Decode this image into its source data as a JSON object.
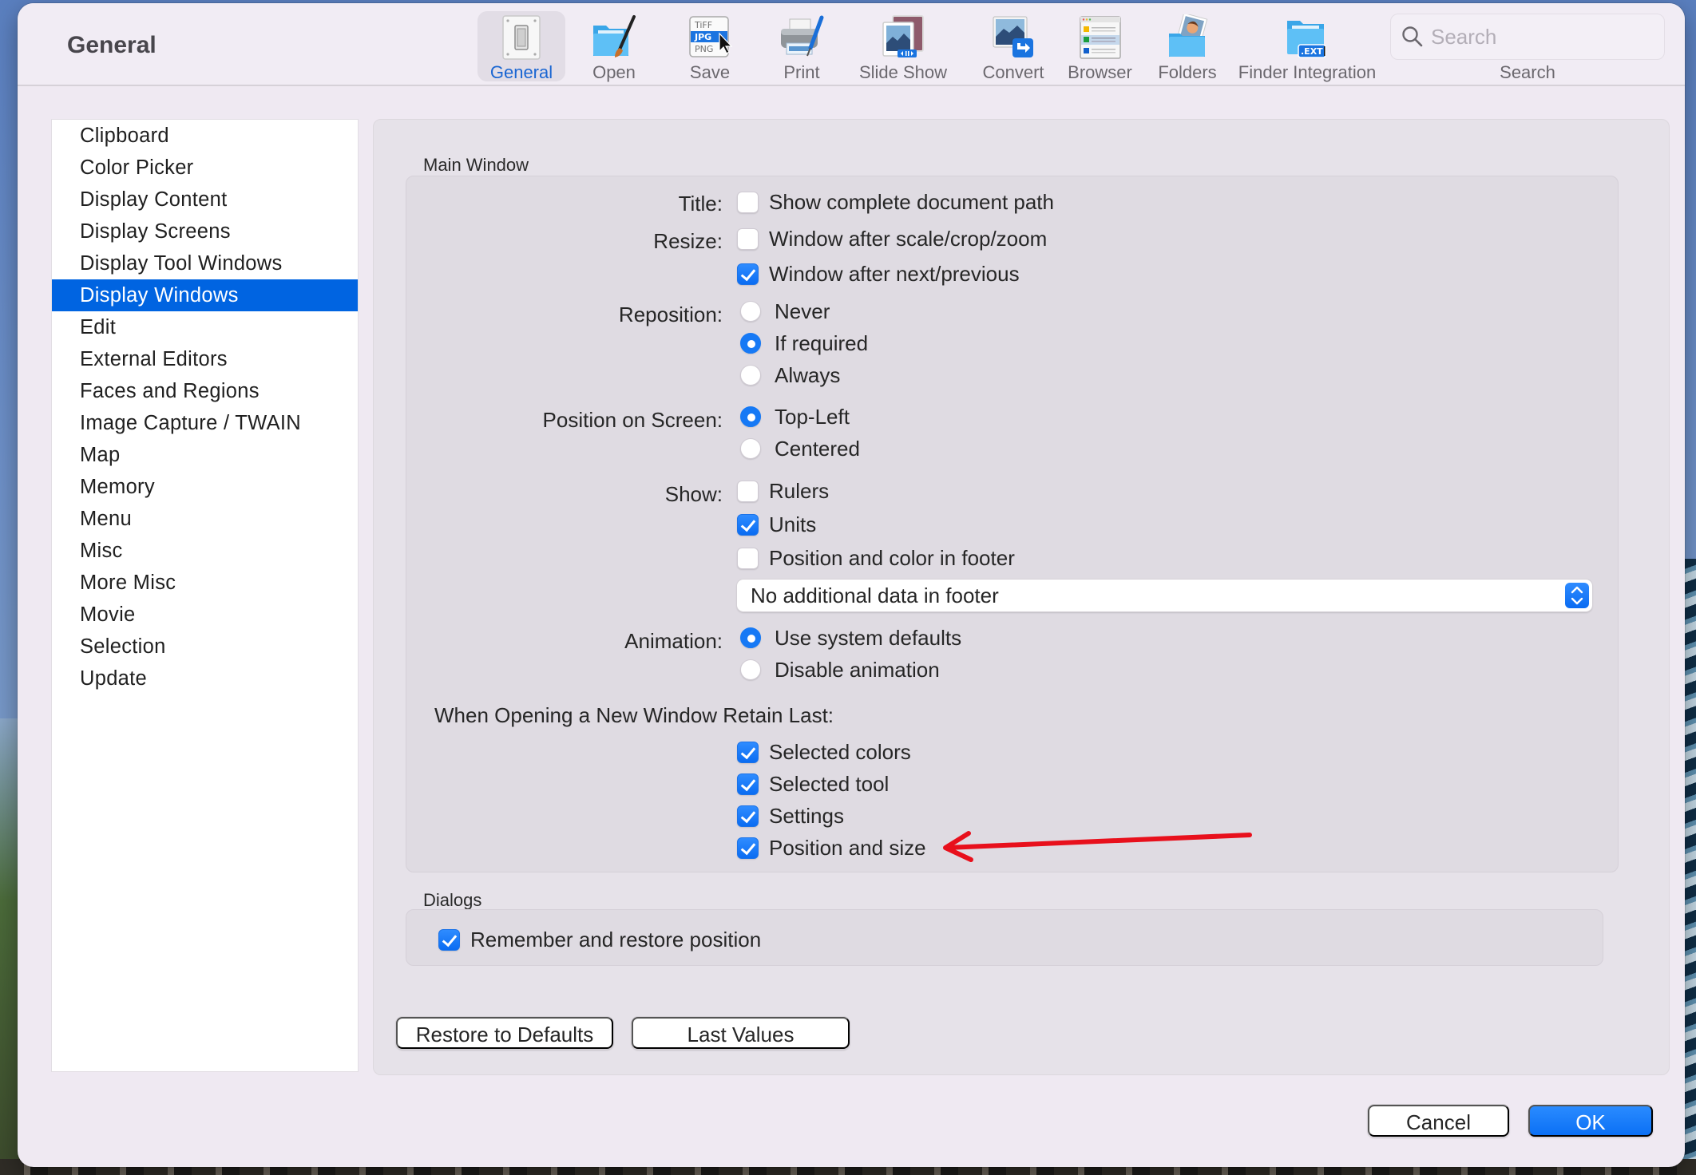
{
  "window": {
    "title": "General"
  },
  "toolbar": {
    "items": [
      {
        "id": "general",
        "label": "General",
        "icon": "light-switch-icon",
        "active": true
      },
      {
        "id": "open",
        "label": "Open",
        "icon": "folder-brush-icon",
        "active": false
      },
      {
        "id": "save",
        "label": "Save",
        "icon": "file-formats-icon",
        "active": false
      },
      {
        "id": "print",
        "label": "Print",
        "icon": "printer-icon",
        "active": false
      },
      {
        "id": "slideshow",
        "label": "Slide Show",
        "icon": "slideshow-icon",
        "active": false
      },
      {
        "id": "convert",
        "label": "Convert",
        "icon": "convert-icon",
        "active": false
      },
      {
        "id": "browser",
        "label": "Browser",
        "icon": "browser-icon",
        "active": false
      },
      {
        "id": "folders",
        "label": "Folders",
        "icon": "folders-icon",
        "active": false
      },
      {
        "id": "finder",
        "label": "Finder Integration",
        "icon": "finder-ext-icon",
        "active": false
      }
    ],
    "save_icon_text": {
      "tiff": "TiFF",
      "jpg": "JPG",
      "png": "PNG"
    },
    "finder_icon_text": ".EXT",
    "search": {
      "placeholder": "Search",
      "value": "",
      "caption": "Search"
    }
  },
  "sidebar": {
    "selected": "Display Windows",
    "items": [
      "Clipboard",
      "Color Picker",
      "Display Content",
      "Display Screens",
      "Display Tool Windows",
      "Display Windows",
      "Edit",
      "External Editors",
      "Faces and Regions",
      "Image Capture / TWAIN",
      "Map",
      "Memory",
      "Menu",
      "Misc",
      "More Misc",
      "Movie",
      "Selection",
      "Update"
    ]
  },
  "main_window": {
    "group_title": "Main Window",
    "title_label": "Title:",
    "title_options": [
      {
        "label": "Show complete document path",
        "checked": false
      }
    ],
    "resize_label": "Resize:",
    "resize_options": [
      {
        "label": "Window after scale/crop/zoom",
        "checked": false
      },
      {
        "label": "Window after next/previous",
        "checked": true
      }
    ],
    "reposition_label": "Reposition:",
    "reposition_options": [
      {
        "label": "Never",
        "selected": false
      },
      {
        "label": "If required",
        "selected": true
      },
      {
        "label": "Always",
        "selected": false
      }
    ],
    "position_label": "Position on Screen:",
    "position_options": [
      {
        "label": "Top-Left",
        "selected": true
      },
      {
        "label": "Centered",
        "selected": false
      }
    ],
    "show_label": "Show:",
    "show_options": [
      {
        "label": "Rulers",
        "checked": false
      },
      {
        "label": "Units",
        "checked": true
      },
      {
        "label": "Position and color in footer",
        "checked": false
      }
    ],
    "footer_select": {
      "value": "No additional data in footer"
    },
    "animation_label": "Animation:",
    "animation_options": [
      {
        "label": "Use system defaults",
        "selected": true
      },
      {
        "label": "Disable animation",
        "selected": false
      }
    ],
    "retain_label": "When Opening a New Window Retain Last:",
    "retain_options": [
      {
        "label": "Selected colors",
        "checked": true
      },
      {
        "label": "Selected tool",
        "checked": true
      },
      {
        "label": "Settings",
        "checked": true
      },
      {
        "label": "Position and size",
        "checked": true
      }
    ]
  },
  "dialogs": {
    "group_title": "Dialogs",
    "options": [
      {
        "label": "Remember and restore position",
        "checked": true
      }
    ]
  },
  "buttons": {
    "restore_defaults": "Restore to Defaults",
    "last_values": "Last Values",
    "cancel": "Cancel",
    "ok": "OK"
  },
  "annotation": {
    "type": "arrow",
    "color": "#e8101c",
    "points_to": "Position and size"
  },
  "colors": {
    "accent": "#0a6cf2",
    "selection": "#0064e1",
    "window_bg": "#efe9f2"
  }
}
